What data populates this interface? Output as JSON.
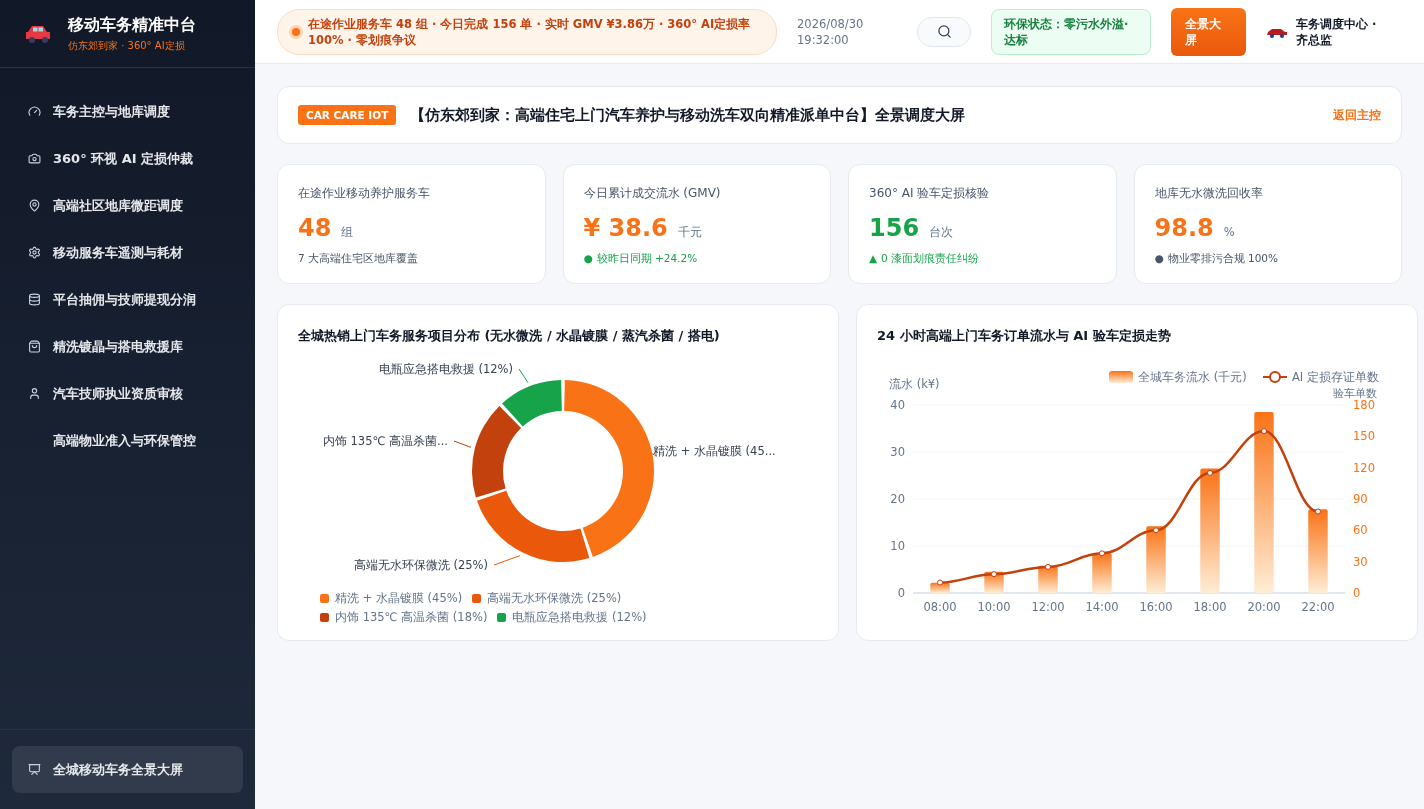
{
  "brand": {
    "title": "移动车务精准中台",
    "subtitle": "仿东郊到家 · 360° AI定损"
  },
  "sidebar": {
    "items": [
      {
        "label": "车务主控与地库调度",
        "selected": false
      },
      {
        "label": "360° 环视 AI 定损仲裁",
        "selected": false
      },
      {
        "label": "高端社区地库微距调度",
        "selected": false
      },
      {
        "label": "移动服务车遥测与耗材",
        "selected": false
      },
      {
        "label": "平台抽佣与技师提现分润",
        "selected": false
      },
      {
        "label": "精洗镀晶与搭电救援库",
        "selected": false
      },
      {
        "label": "汽车技师执业资质审核",
        "selected": false
      },
      {
        "label": "高端物业准入与环保管控",
        "selected": false
      }
    ],
    "footer_item": {
      "label": "全城移动车务全景大屏",
      "selected": true
    }
  },
  "header": {
    "ticker": "在途作业服务车 48 组 · 今日完成 156 单 · 实时 GMV ¥3.86万 · 360° AI定损率 100% · 零划痕争议",
    "date": "2026/08/30",
    "time": "19:32:00",
    "eco_status": "环保状态：零污水外溢·达标",
    "fullscreen_button": "全景大屏",
    "user": "车务调度中心 · 齐总监"
  },
  "banner": {
    "tag": "CAR CARE IOT",
    "title": "【仿东郊到家：高端住宅上门汽车养护与移动洗车双向精准派单中台】全景调度大屏",
    "link": "返回主控"
  },
  "stats": [
    {
      "label": "在途作业移动养护服务车",
      "value": "48",
      "unit": "组",
      "color": "#f97316",
      "note": {
        "text": "7 大高端住宅区地库覆盖"
      }
    },
    {
      "label": "今日累计成交流水 (GMV)",
      "value": "¥ 38.6",
      "unit": "千元",
      "color": "#f97316",
      "note": {
        "marker": "●",
        "text": "较昨日同期 +24.2%",
        "color": "#16a34a"
      }
    },
    {
      "label": "360° AI 验车定损核验",
      "value": "156",
      "unit": "台次",
      "color": "#16a34a",
      "note": {
        "marker": "▲",
        "text": "0 漆面划痕责任纠纷",
        "color": "#16a34a"
      }
    },
    {
      "label": "地库无水微洗回收率",
      "value": "98.8",
      "unit": "%",
      "color": "#f97316",
      "note": {
        "marker": "●",
        "text": "物业零排污合规 100%",
        "color": "#475569"
      }
    }
  ],
  "donut_card": {
    "title": "全城热销上门车务服务项目分布 (无水微洗 / 水晶镀膜 / 蒸汽杀菌 / 搭电)",
    "chart_data": {
      "type": "donut",
      "categories": [
        "精洗 + 水晶镀膜 (45%)",
        "高端无水环保微洗 (25%)",
        "内饰 135℃ 高温杀菌 (18%)",
        "电瓶应急搭电救援 (12%)"
      ],
      "values": [
        45,
        25,
        18,
        12
      ],
      "colors": [
        "#f97316",
        "#ea580c",
        "#c2410c",
        "#16a34a"
      ]
    },
    "callouts": [
      "精洗 + 水晶镀膜 (45...",
      "高端无水环保微洗 (25%)",
      "内饰 135℃ 高温杀菌...",
      "电瓶应急搭电救援 (12%)"
    ]
  },
  "trend_card": {
    "title": "24 小时高端上门车务订单流水与 AI 验车定损走势",
    "chart_data": {
      "type": "bar",
      "grid": true,
      "legend": "top-right",
      "categories": [
        "08:00",
        "10:00",
        "12:00",
        "14:00",
        "16:00",
        "18:00",
        "20:00",
        "22:00"
      ],
      "ylabel": "流水 (k¥)",
      "ylim": [
        0,
        40
      ],
      "yticks": [
        0,
        10,
        20,
        30,
        40
      ],
      "series": [
        {
          "name": "全城车务流水 (千元)",
          "color": "#f97316",
          "values": [
            2.2,
            4.5,
            5.8,
            8.5,
            14.2,
            26.5,
            38.5,
            17.8
          ]
        }
      ]
    },
    "line_overlay": {
      "chart_data": {
        "type": "line",
        "legend": "top-right",
        "ylabel": "验车单数",
        "ylim": [
          0,
          180
        ],
        "yticks": [
          0,
          30,
          60,
          90,
          120,
          150,
          180
        ],
        "series": [
          {
            "name": "AI 定损存证单数",
            "color": "#c2410c",
            "marker": "circle",
            "values": [
              10,
              18,
              25,
              38,
              60,
              115,
              155,
              78
            ]
          }
        ]
      }
    }
  }
}
